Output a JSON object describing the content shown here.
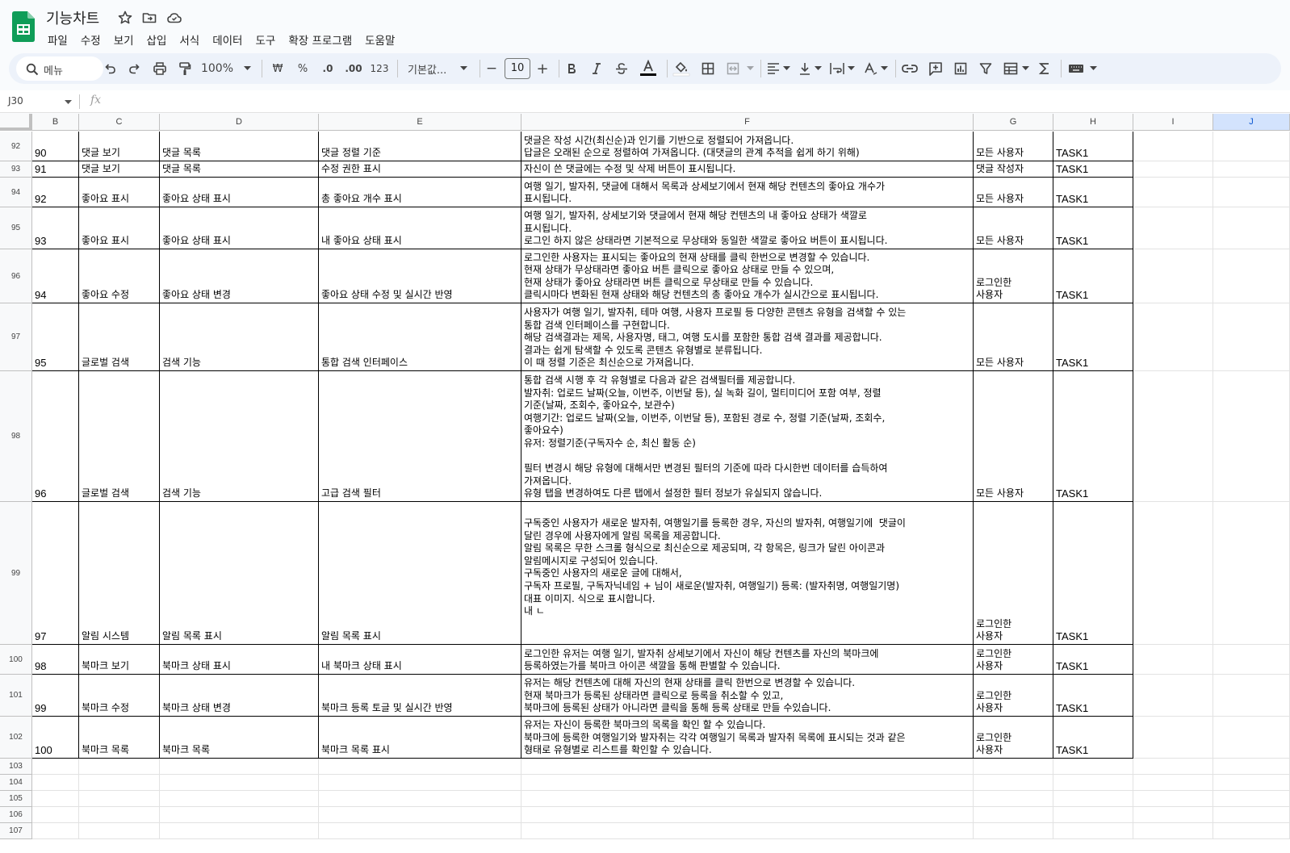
{
  "doc": {
    "title": "기능차트",
    "menu": [
      "파일",
      "수정",
      "보기",
      "삽입",
      "서식",
      "데이터",
      "도구",
      "확장 프로그램",
      "도움말"
    ]
  },
  "toolbar": {
    "search_label": "메뉴",
    "zoom": "100%",
    "currency": "₩",
    "percent": "%",
    "dec_decrease": ".0",
    "dec_increase": ".00",
    "number_format": "123",
    "font": "기본값...",
    "font_size": "10",
    "minus": "−",
    "plus": "+"
  },
  "formula": {
    "cell_ref": "J30",
    "fx": "fx",
    "value": ""
  },
  "columns": [
    "B",
    "C",
    "D",
    "E",
    "F",
    "G",
    "H",
    "I",
    "J"
  ],
  "selected_column": "J",
  "rows": [
    {
      "num": "92",
      "id": "90",
      "c": "댓글 보기",
      "d": "댓글 목록",
      "e": "댓글 정렬 기준",
      "f": "댓글은 작성 시간(최신순)과 인기를 기반으로 정렬되어 가져옵니다.\n답글은 오래된 순으로 정렬하여 가져옵니다. (대댓글의 관계 추적을 쉽게 하기 위해)",
      "g": "모든 사용자",
      "h": "TASK1"
    },
    {
      "num": "93",
      "id": "91",
      "c": "댓글 보기",
      "d": "댓글 목록",
      "e": "수정 권한 표시",
      "f": "자신이 쓴 댓글에는 수정 및 삭제 버튼이 표시됩니다.",
      "g": "댓글 작성자",
      "h": "TASK1"
    },
    {
      "num": "94",
      "id": "92",
      "c": "좋아요 표시",
      "d": "좋아요 상태 표시",
      "e": "총 좋아요 개수 표시",
      "f": "여행 일기, 발자취, 댓글에 대해서 목록과 상세보기에서 현재 해당 컨텐츠의 좋아요 개수가\n표시됩니다.",
      "g": "모든 사용자",
      "h": "TASK1"
    },
    {
      "num": "95",
      "id": "93",
      "c": "좋아요 표시",
      "d": "좋아요 상태 표시",
      "e": "내 좋아요 상태 표시",
      "f": "여행 일기, 발자취, 상세보기와 댓글에서 현재 해당 컨텐츠의 내 좋아요 상태가 색깔로\n표시됩니다.\n로그인 하지 않은 상태라면 기본적으로 무상태와 동일한 색깔로 좋아요 버튼이 표시됩니다.",
      "g": "모든 사용자",
      "h": "TASK1"
    },
    {
      "num": "96",
      "id": "94",
      "c": "좋아요 수정",
      "d": "좋아요 상태 변경",
      "e": "좋아요 상태 수정 및 실시간 반영",
      "f": "로그인한 사용자는 표시되는 좋아요의 현재 상태를 클릭 한번으로 변경할 수 있습니다.\n현재 상태가 무상태라면 좋아요 버튼 클릭으로 좋아요 상태로 만들 수 있으며,\n현재 상태가 좋아요 상태라면 버튼 클릭으로 무상태로 만들 수 있습니다.\n클릭시마다 변화된 현재 상태와 해당 컨텐츠의 총 좋아요 개수가 실시간으로 표시됩니다.",
      "g": "로그인한\n사용자",
      "h": "TASK1"
    },
    {
      "num": "97",
      "id": "95",
      "c": "글로벌 검색",
      "d": "검색 기능",
      "e": "통합 검색 인터페이스",
      "f": "사용자가 여행 일기, 발자취, 테마 여행, 사용자 프로필 등 다양한 콘텐츠 유형을 검색할 수 있는\n통합 검색 인터페이스를 구현합니다.\n해당 검색결과는 제목, 사용자명, 태그, 여행 도시를 포함한 통합 검색 결과를 제공합니다.\n결과는 쉽게 탐색할 수 있도록 콘텐츠 유형별로 분류됩니다.\n이 때 정렬 기준은 최신순으로 가져옵니다.",
      "g": "모든 사용자",
      "h": "TASK1"
    },
    {
      "num": "98",
      "id": "96",
      "c": "글로벌 검색",
      "d": "검색 기능",
      "e": "고급 검색 필터",
      "f": "통합 검색 시행 후 각 유형별로 다음과 같은 검색필터를 제공합니다.\n발자취: 업로드 날짜(오늘, 이번주, 이번달 등), 실 녹화 길이, 멀티미디어 포함 여부, 정렬\n기준(날짜, 조회수, 좋아요수, 보관수)\n여행기간: 업로드 날짜(오늘, 이번주, 이번달 등), 포함된 경로 수, 정렬 기준(날짜, 조회수,\n좋아요수)\n유저: 정렬기준(구독자수 순, 최신 활동 순)\n\n필터 변경시 해당 유형에 대해서만 변경된 필터의 기준에 따라 다시한번 데이터를 습득하여\n가져옵니다.\n유형 탭을 변경하여도 다른 탭에서 설정한 필터 정보가 유실되지 않습니다.",
      "g": "모든 사용자",
      "h": "TASK1"
    },
    {
      "num": "99",
      "id": "97",
      "c": "알림 시스템",
      "d": "알림 목록 표시",
      "e": "알림 목록 표시",
      "f": "구독중인 사용자가 새로운 발자취, 여행일기를 등록한 경우, 자신의 발자취, 여행일기에  댓글이\n달린 경우에 사용자에게 알림 목록을 제공합니다.\n알림 목록은 무한 스크롤 형식으로 최신순으로 제공되며, 각 항목은, 링크가 달린 아이콘과\n알림메시지로 구성되어 있습니다.\n구독중인 사용자의 새로운 글에 대해서,\n구독자 프로필, 구독자닉네임 + 님이 새로운(발자취, 여행일기) 등록: (발자취명, 여행일기명)\n대표 이미지. 식으로 표시합니다.\n내 ㄴ\n\n\n",
      "g": "로그인한\n사용자",
      "h": "TASK1"
    },
    {
      "num": "100",
      "id": "98",
      "c": "북마크 보기",
      "d": "북마크 상태 표시",
      "e": "내 북마크 상태 표시",
      "f": "로그인한 유저는 여행 일기, 발자취 상세보기에서 자신이 해당 컨텐츠를 자신의 북마크에\n등록하였는가를 북마크 아이콘 색깔을 통해 판별할 수 있습니다.",
      "g": "로그인한\n사용자",
      "h": "TASK1"
    },
    {
      "num": "101",
      "id": "99",
      "c": "북마크 수정",
      "d": "북마크 상태 변경",
      "e": "북마크 등록 토글 및 실시간 반영",
      "f": "유저는 해당 컨텐츠에 대해 자신의 현재 상태를 클릭 한번으로 변경할 수 있습니다.\n현재 북마크가 등록된 상태라면 클릭으로 등록을 취소할 수 있고,\n북마크에 등록된 상태가 아니라면 클릭을 통해 등록 상태로 만들 수있습니다.",
      "g": "로그인한\n사용자",
      "h": "TASK1"
    },
    {
      "num": "102",
      "id": "100",
      "c": "북마크 목록",
      "d": "북마크 목록",
      "e": "북마크 목록 표시",
      "f": "유저는 자신이 등록한 북마크의 목록을 확인 할 수 있습니다.\n북마크에 등록한 여행일기와 발자취는 각각 여행일기 목록과 발자취 목록에 표시되는 것과 같은\n형태로 유형별로 리스트를 확인할 수 있습니다.",
      "g": "로그인한\n사용자",
      "h": "TASK1"
    }
  ],
  "empty_rows": [
    "103",
    "104",
    "105",
    "106",
    "107"
  ]
}
